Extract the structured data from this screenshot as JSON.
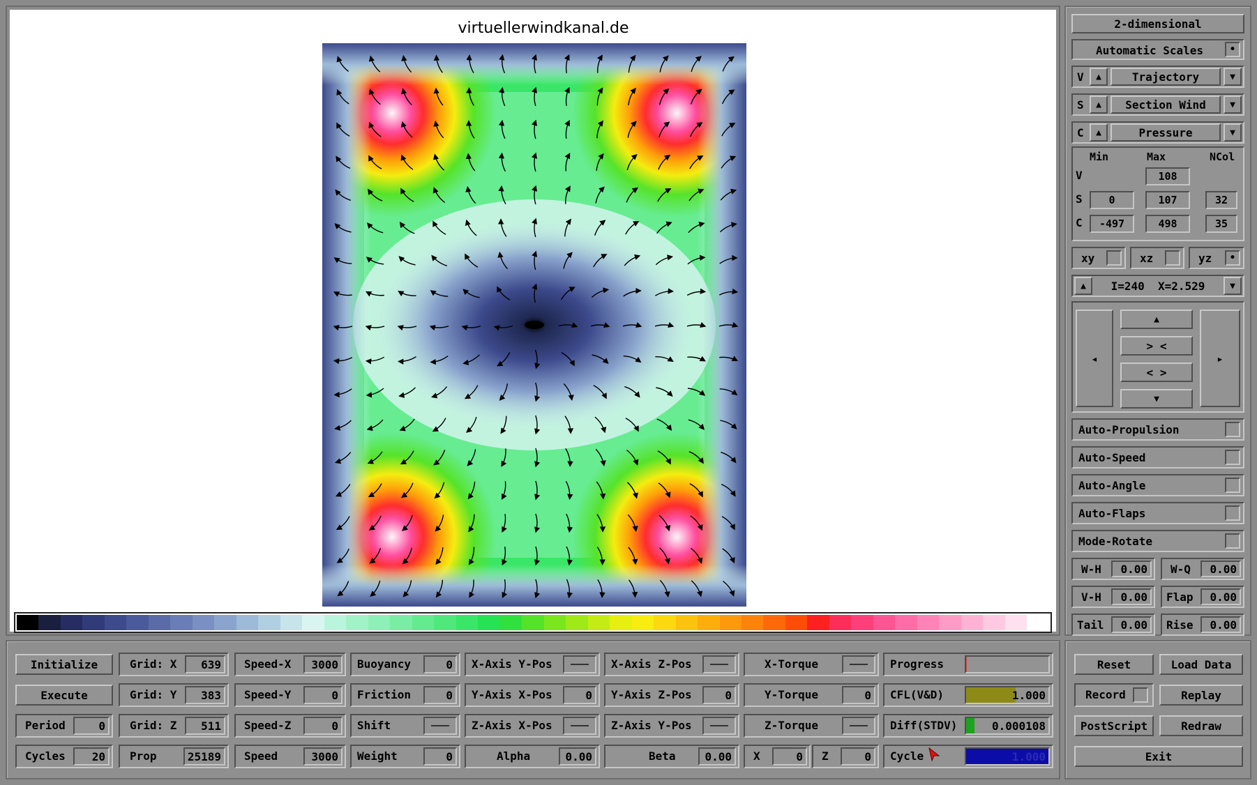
{
  "viewer": {
    "title": "virtuellerwindkanal.de"
  },
  "colorbar": [
    "#000000",
    "#1a1f40",
    "#262d63",
    "#323b7a",
    "#3d4a8c",
    "#4b5a9a",
    "#5b6ba8",
    "#6a7db6",
    "#7a90c2",
    "#8aa4cd",
    "#9dbad8",
    "#b0cfe1",
    "#c6e4ea",
    "#d9f5f2",
    "#b9f5dc",
    "#a2f2c8",
    "#8df0b6",
    "#79eda3",
    "#64eb8f",
    "#4fe87b",
    "#3ae667",
    "#25e353",
    "#30e03d",
    "#55e32a",
    "#7ae61e",
    "#9fe919",
    "#c4ec14",
    "#e6ef10",
    "#f8ec10",
    "#fbd80f",
    "#fcc30e",
    "#fdae0d",
    "#fe980c",
    "#ff820a",
    "#ff6909",
    "#ff4d08",
    "#ff2020",
    "#ff2d5a",
    "#ff3f7a",
    "#ff5592",
    "#ff6ca6",
    "#ff83b7",
    "#ff9bc6",
    "#ffb2d4",
    "#ffc9e1",
    "#ffe0ee",
    "#ffffff"
  ],
  "sidebar": {
    "mode_button": "2-dimensional",
    "automatic_scales": "Automatic Scales",
    "automatic_scales_check": "•",
    "selectors": [
      {
        "prefix": "V",
        "value": "Trajectory"
      },
      {
        "prefix": "S",
        "value": "Section Wind"
      },
      {
        "prefix": "C",
        "value": "Pressure"
      }
    ],
    "scales": {
      "header_min": "Min",
      "header_max": "Max",
      "header_ncol": "NCol",
      "row_v": {
        "label": "V",
        "max": "108"
      },
      "row_s": {
        "label": "S",
        "min": "0",
        "max": "107",
        "ncol": "32"
      },
      "row_c": {
        "label": "C",
        "min": "-497",
        "max": "498",
        "ncol": "35"
      }
    },
    "planes": [
      {
        "label": "xy",
        "checked": ""
      },
      {
        "label": "xz",
        "checked": ""
      },
      {
        "label": "yz",
        "checked": "•"
      }
    ],
    "slice": "I=240  X=2.529",
    "nav": {
      "up": "▲",
      "zoom_in": "> <",
      "zoom_out": "< >",
      "down": "▼",
      "left": "◂",
      "right": "▸"
    },
    "toggles": [
      "Auto-Propulsion",
      "Auto-Speed",
      "Auto-Angle",
      "Auto-Flaps",
      "Mode-Rotate"
    ],
    "params": [
      {
        "label": "W-H",
        "value": "0.00"
      },
      {
        "label": "W-Q",
        "value": "0.00"
      },
      {
        "label": "V-H",
        "value": "0.00"
      },
      {
        "label": "Flap",
        "value": "0.00"
      },
      {
        "label": "Tail",
        "value": "0.00"
      },
      {
        "label": "Rise",
        "value": "0.00"
      }
    ]
  },
  "bottom": {
    "initialize": "Initialize",
    "execute": "Execute",
    "period": {
      "label": "Period",
      "value": "0"
    },
    "cycles": {
      "label": "Cycles",
      "value": "20"
    },
    "grid_x": {
      "label": "Grid: X",
      "value": "639"
    },
    "grid_y": {
      "label": "Grid: Y",
      "value": "383"
    },
    "grid_z": {
      "label": "Grid: Z",
      "value": "511"
    },
    "prop": {
      "label": "Prop",
      "value": "25189"
    },
    "speed_x": {
      "label": "Speed-X",
      "value": "3000"
    },
    "speed_y": {
      "label": "Speed-Y",
      "value": "0"
    },
    "speed_z": {
      "label": "Speed-Z",
      "value": "0"
    },
    "speed": {
      "label": "Speed",
      "value": "3000"
    },
    "buoyancy": {
      "label": "Buoyancy",
      "value": "0"
    },
    "friction": {
      "label": "Friction",
      "value": "0"
    },
    "shift": {
      "label": "Shift"
    },
    "weight": {
      "label": "Weight",
      "value": "0"
    },
    "xaxis_ypos": {
      "label": "X-Axis Y-Pos"
    },
    "yaxis_xpos": {
      "label": "Y-Axis X-Pos",
      "value": "0"
    },
    "zaxis_xpos": {
      "label": "Z-Axis X-Pos"
    },
    "alpha": {
      "label": "Alpha",
      "value": "0.00"
    },
    "xaxis_zpos": {
      "label": "X-Axis Z-Pos"
    },
    "yaxis_zpos": {
      "label": "Y-Axis Z-Pos",
      "value": "0"
    },
    "zaxis_ypos": {
      "label": "Z-Axis Y-Pos"
    },
    "beta": {
      "label": "Beta",
      "value": "0.00"
    },
    "x_torque": {
      "label": "X-Torque"
    },
    "y_torque": {
      "label": "Y-Torque",
      "value": "0"
    },
    "z_torque": {
      "label": "Z-Torque"
    },
    "x": {
      "label": "X",
      "value": "0"
    },
    "z": {
      "label": "Z",
      "value": "0"
    },
    "progress": {
      "label": "Progress",
      "fraction": 0.01
    },
    "cfl": {
      "label": "CFL(V&D)",
      "value": "1.000"
    },
    "diff": {
      "label": "Diff(STDV)",
      "value": "0.000108"
    },
    "cycle": {
      "label": "Cycle",
      "value": "1.000"
    }
  },
  "actions": {
    "reset": "Reset",
    "load_data": "Load Data",
    "record": "Record",
    "replay": "Replay",
    "postscript": "PostScript",
    "redraw": "Redraw",
    "exit": "Exit"
  }
}
